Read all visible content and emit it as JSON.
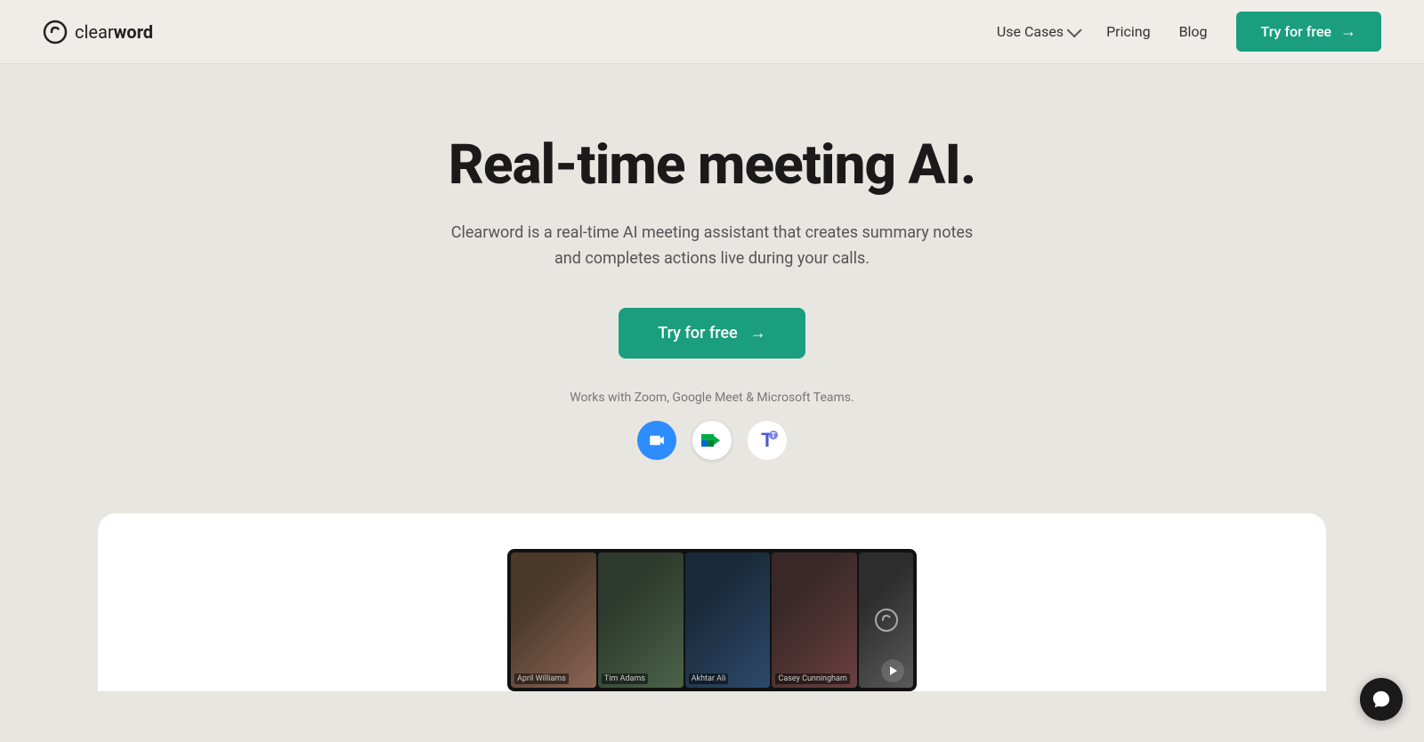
{
  "brand": {
    "name_part1": "clear",
    "name_part2": "word",
    "logo_alt": "Clearword logo"
  },
  "nav": {
    "use_cases_label": "Use Cases",
    "pricing_label": "Pricing",
    "blog_label": "Blog",
    "try_free_label": "Try for free"
  },
  "hero": {
    "title": "Real-time meeting AI.",
    "subtitle": "Clearword is a real-time AI meeting assistant that creates summary notes and completes actions live during your calls.",
    "cta_label": "Try for free",
    "works_with_text": "Works with Zoom, Google Meet & Microsoft Teams."
  },
  "platforms": [
    {
      "name": "Zoom",
      "icon_type": "zoom"
    },
    {
      "name": "Google Meet",
      "icon_type": "meet"
    },
    {
      "name": "Microsoft Teams",
      "icon_type": "teams"
    }
  ],
  "video_preview": {
    "participants": [
      {
        "name": "April Williams"
      },
      {
        "name": "Tim Adams"
      },
      {
        "name": "Akhtar Ali"
      },
      {
        "name": "Casey Cunningham"
      },
      {
        "name": ""
      }
    ]
  }
}
